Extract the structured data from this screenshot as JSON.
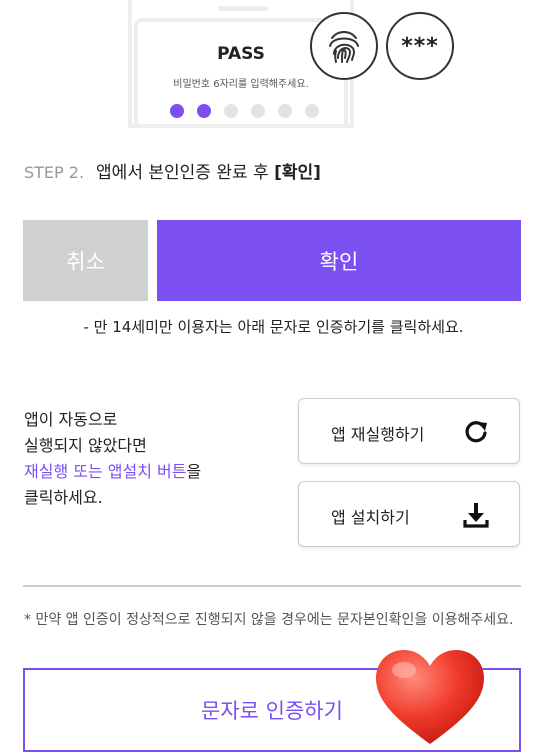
{
  "illustration": {
    "title": "PASS",
    "subtitle": "비밀번호 6자리를 입력해주세요.",
    "pin_filled": 2,
    "pin_total": 6,
    "masked_text": "***"
  },
  "step": {
    "label": "STEP 2.",
    "text": "앱에서 본인인증 완료 후 ",
    "bold": "[확인]"
  },
  "buttons": {
    "cancel": "취소",
    "confirm": "확인"
  },
  "notice": "- 만 14세미만 이용자는 아래 문자로 인증하기를 클릭하세요.",
  "guide": {
    "line1": "앱이 자동으로",
    "line2": "실행되지 않았다면",
    "line3_purple": "재실행 또는 앱설치 버튼",
    "line3_rest": "을",
    "line4": "클릭하세요."
  },
  "app_buttons": {
    "rerun": "앱 재실행하기",
    "install": "앱 설치하기"
  },
  "footer_note": "* 만약 앱 인증이 정상적으로 진행되지 않을 경우에는 문자본인확인을 이용해주세요.",
  "sms_button": "문자로 인증하기",
  "colors": {
    "accent": "#7b4ff0",
    "cancel_bg": "#d0d0d0"
  }
}
